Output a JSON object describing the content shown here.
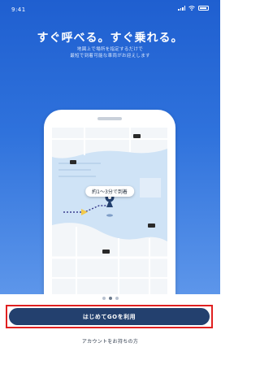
{
  "status_bar": {
    "time": "9:41"
  },
  "headline": "すぐ呼べる。すぐ乗れる。",
  "subtext": [
    "地図上で場所を指定するだけで",
    "最短で到着可能な車両がお迎えします"
  ],
  "map": {
    "eta_label": "約1〜3分で到着"
  },
  "pager": {
    "pages": 3,
    "active_index": 1
  },
  "primary_button": {
    "label": "はじめてGOを利用"
  },
  "secondary_link": {
    "label": "アカウントをお持ちの方"
  },
  "colors": {
    "brand_blue": "#2f72dc",
    "button_navy": "#23406e",
    "highlight_red": "#e02020",
    "map_water": "#cfe3f6"
  }
}
